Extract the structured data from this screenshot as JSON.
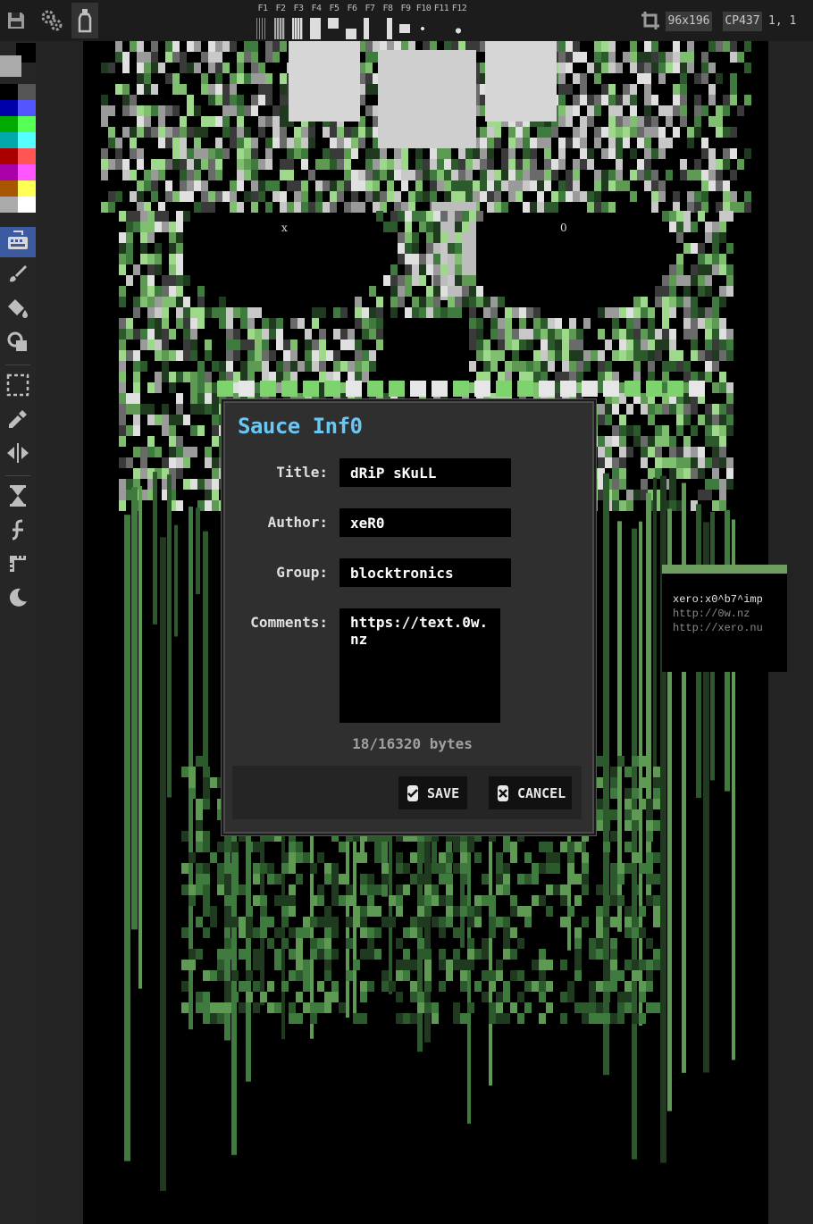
{
  "toolbar": {
    "save_icon": "floppy-disk-icon",
    "settings_icon": "gears-icon",
    "sauce_icon": "bottle-icon",
    "fkeys": [
      "F1",
      "F2",
      "F3",
      "F4",
      "F5",
      "F6",
      "F7",
      "F8",
      "F9",
      "F10",
      "F11",
      "F12"
    ],
    "canvas_icon": "crop-icon",
    "canvas_size": "96x196",
    "font_name": "CP437",
    "cursor_position": "1, 1"
  },
  "palette": {
    "foreground": "#aaaaaa",
    "background": "#000000",
    "colors": [
      "#000000",
      "#555555",
      "#0000aa",
      "#5555ff",
      "#00aa00",
      "#55ff55",
      "#00aaaa",
      "#55ffff",
      "#aa0000",
      "#ff5555",
      "#aa00aa",
      "#ff55ff",
      "#aa5500",
      "#ffff55",
      "#aaaaaa",
      "#ffffff"
    ]
  },
  "tools": [
    {
      "name": "keyboard-icon",
      "active": true
    },
    {
      "name": "brush-icon",
      "active": false
    },
    {
      "name": "fill-bucket-icon",
      "active": false
    },
    {
      "name": "shapes-icon",
      "active": false
    },
    {
      "name": "selection-icon",
      "active": false
    },
    {
      "name": "eyedropper-icon",
      "active": false
    },
    {
      "name": "mirror-icon",
      "active": false
    },
    {
      "name": "hourglass-icon",
      "active": false
    },
    {
      "name": "font-icon",
      "active": false
    },
    {
      "name": "ruler-icon",
      "active": false
    },
    {
      "name": "moon-icon",
      "active": false
    }
  ],
  "canvas": {
    "eye_left": "x",
    "eye_right": "0",
    "signature": [
      "xero:x0^b7^imp",
      "http://0w.nz",
      "http://xero.nu"
    ]
  },
  "dialog": {
    "title": "Sauce Inf0",
    "title_label": "Title:",
    "title_value": "dRiP sKuLL",
    "author_label": "Author:",
    "author_value": "xeR0",
    "group_label": "Group:",
    "group_value": "blocktronics",
    "comments_label": "Comments:",
    "comments_value": "https://text.0w.nz",
    "byte_count": "18/16320 bytes",
    "save_label": "SAVE",
    "cancel_label": "CANCEL",
    "accent_color": "#6ac6f2"
  }
}
